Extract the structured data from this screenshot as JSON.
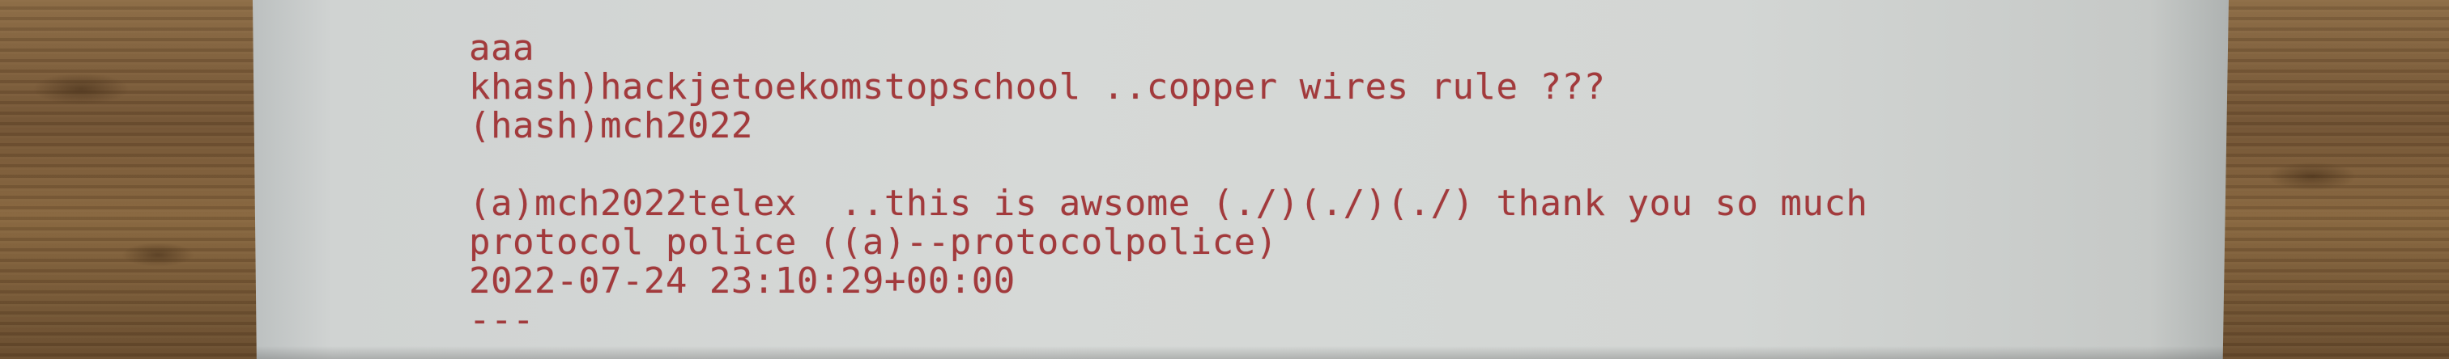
{
  "printout": {
    "line1": "aaa",
    "line2": "khash)hackjetoekomstopschool ..copper wires rule ???",
    "line3": "(hash)mch2022",
    "line4": "(a)mch2022telex  ..this is awsome (./)(./)(./) thank you so much",
    "line5": "protocol police ((a)--protocolpolice)",
    "line6": "2022-07-24 23:10:29+00:00",
    "line7": "---"
  },
  "colors": {
    "ink": "#a23a3c",
    "paper": "#d6d9d7",
    "wood": "#715233"
  }
}
